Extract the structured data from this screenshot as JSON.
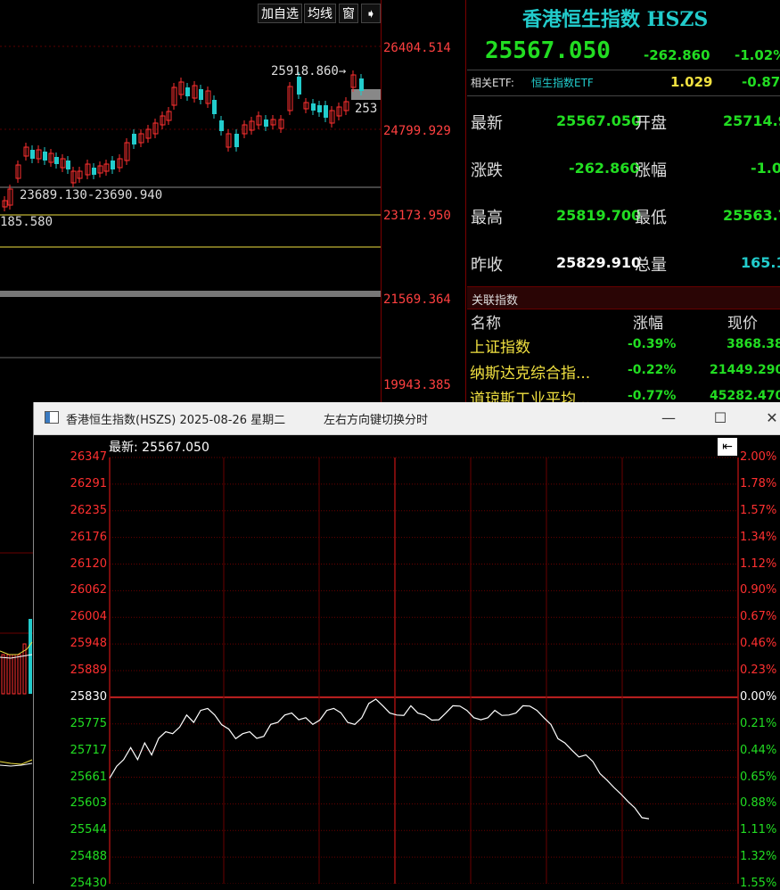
{
  "toolbar": {
    "add_label": "加自选",
    "ma_label": "均线",
    "window_label": "窗"
  },
  "main_chart": {
    "price_labels": [
      "26404.514",
      "24799.929",
      "23173.950",
      "21569.364",
      "19943.385"
    ],
    "annotations": {
      "high": "25918.860→",
      "range": "23689.130-23690.940",
      "left_value": "185.580",
      "partial": "253"
    }
  },
  "quote": {
    "title": "香港恒生指数 HSZS",
    "last": "25567.050",
    "change": "-262.860",
    "change_pct": "-1.02%",
    "etf_label": "相关ETF:",
    "etf_name": "恒生指数ETF",
    "etf_price": "1.029",
    "etf_pct": "-0.87",
    "rows": [
      {
        "l1": "最新",
        "v1": "25567.050",
        "l2": "开盘",
        "v2": "25714.9"
      },
      {
        "l1": "涨跌",
        "v1": "-262.860",
        "l2": "涨幅",
        "v2": "-1.0"
      },
      {
        "l1": "最高",
        "v1": "25819.700",
        "l2": "最低",
        "v2": "25563.7"
      },
      {
        "l1": "昨收",
        "v1": "25829.910",
        "l2": "总量",
        "v2": "165.1"
      }
    ],
    "related_header": "关联指数",
    "col_name": "名称",
    "col_pct": "涨幅",
    "col_price": "现价",
    "related": [
      {
        "name": "上证指数",
        "pct": "-0.39%",
        "price": "3868.38"
      },
      {
        "name": "纳斯达克综合指...",
        "pct": "-0.22%",
        "price": "21449.290"
      },
      {
        "name": "道琼斯工业平均...",
        "pct": "-0.77%",
        "price": "45282.470"
      }
    ]
  },
  "popup": {
    "title": "香港恒生指数(HSZS) 2025-08-26 星期二",
    "hint": "左右方向键切换分时",
    "latest_label": "最新: 25567.050",
    "minimize": "—",
    "maximize": "☐",
    "close": "✕",
    "left_axis": [
      "26347",
      "26291",
      "26235",
      "26176",
      "26120",
      "26062",
      "26004",
      "25948",
      "25889",
      "25830",
      "25775",
      "25717",
      "25661",
      "25603",
      "25544",
      "25488",
      "25430"
    ],
    "right_axis": [
      "2.00%",
      "1.78%",
      "1.57%",
      "1.34%",
      "1.12%",
      "0.90%",
      "0.67%",
      "0.46%",
      "0.23%",
      "0.00%",
      "0.21%",
      "0.44%",
      "0.65%",
      "0.88%",
      "1.11%",
      "1.32%",
      "1.55%"
    ],
    "prev_close": 25829.91
  },
  "chart_data": {
    "type": "line",
    "title": "",
    "ylim": [
      25430,
      26347
    ],
    "y": [
      25660,
      25680,
      25700,
      25720,
      25700,
      25730,
      25710,
      25740,
      25760,
      25750,
      25770,
      25790,
      25780,
      25800,
      25810,
      25790,
      25775,
      25760,
      25745,
      25750,
      25760,
      25740,
      25750,
      25770,
      25780,
      25790,
      25800,
      25780,
      25790,
      25770,
      25785,
      25800,
      25810,
      25795,
      25780,
      25770,
      25790,
      25815,
      25830,
      25810,
      25800,
      25790,
      25795,
      25810,
      25800,
      25790,
      25785,
      25780,
      25800,
      25810,
      25815,
      25800,
      25790,
      25780,
      25790,
      25800,
      25795,
      25790,
      25800,
      25810,
      25815,
      25800,
      25790,
      25770,
      25745,
      25730,
      25720,
      25700,
      25710,
      25690,
      25670,
      25650,
      25640,
      25620,
      25610,
      25590,
      25575,
      25567
    ]
  }
}
